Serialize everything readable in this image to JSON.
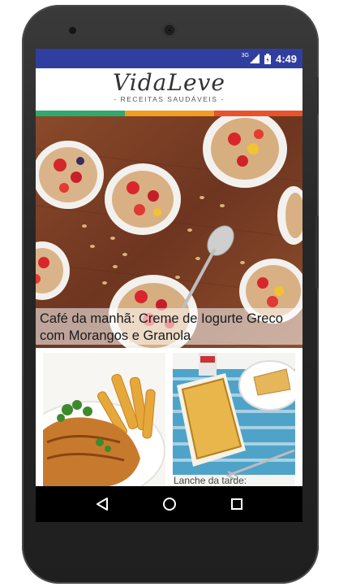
{
  "status_bar": {
    "network": "3G",
    "time": "4:49",
    "bar_color": "#303f9f"
  },
  "header": {
    "brand": "VidaLeve",
    "tagline": "- RECEITAS SAUDÁVEIS -",
    "stripe_colors": [
      "#2eaa6e",
      "#f39c22",
      "#e8532b"
    ]
  },
  "featured": {
    "title": "Café da manhã: Creme de Iogurte Greco com Morangos e Granola",
    "image": "yogurt-strawberry-granola-photo"
  },
  "cards": [
    {
      "image": "grilled-chicken-fries-photo",
      "title": ""
    },
    {
      "image": "cake-slice-photo",
      "title": "Lanche da tarde:"
    }
  ],
  "nav": {
    "back": "back-icon",
    "home": "home-icon",
    "recents": "recents-icon"
  }
}
